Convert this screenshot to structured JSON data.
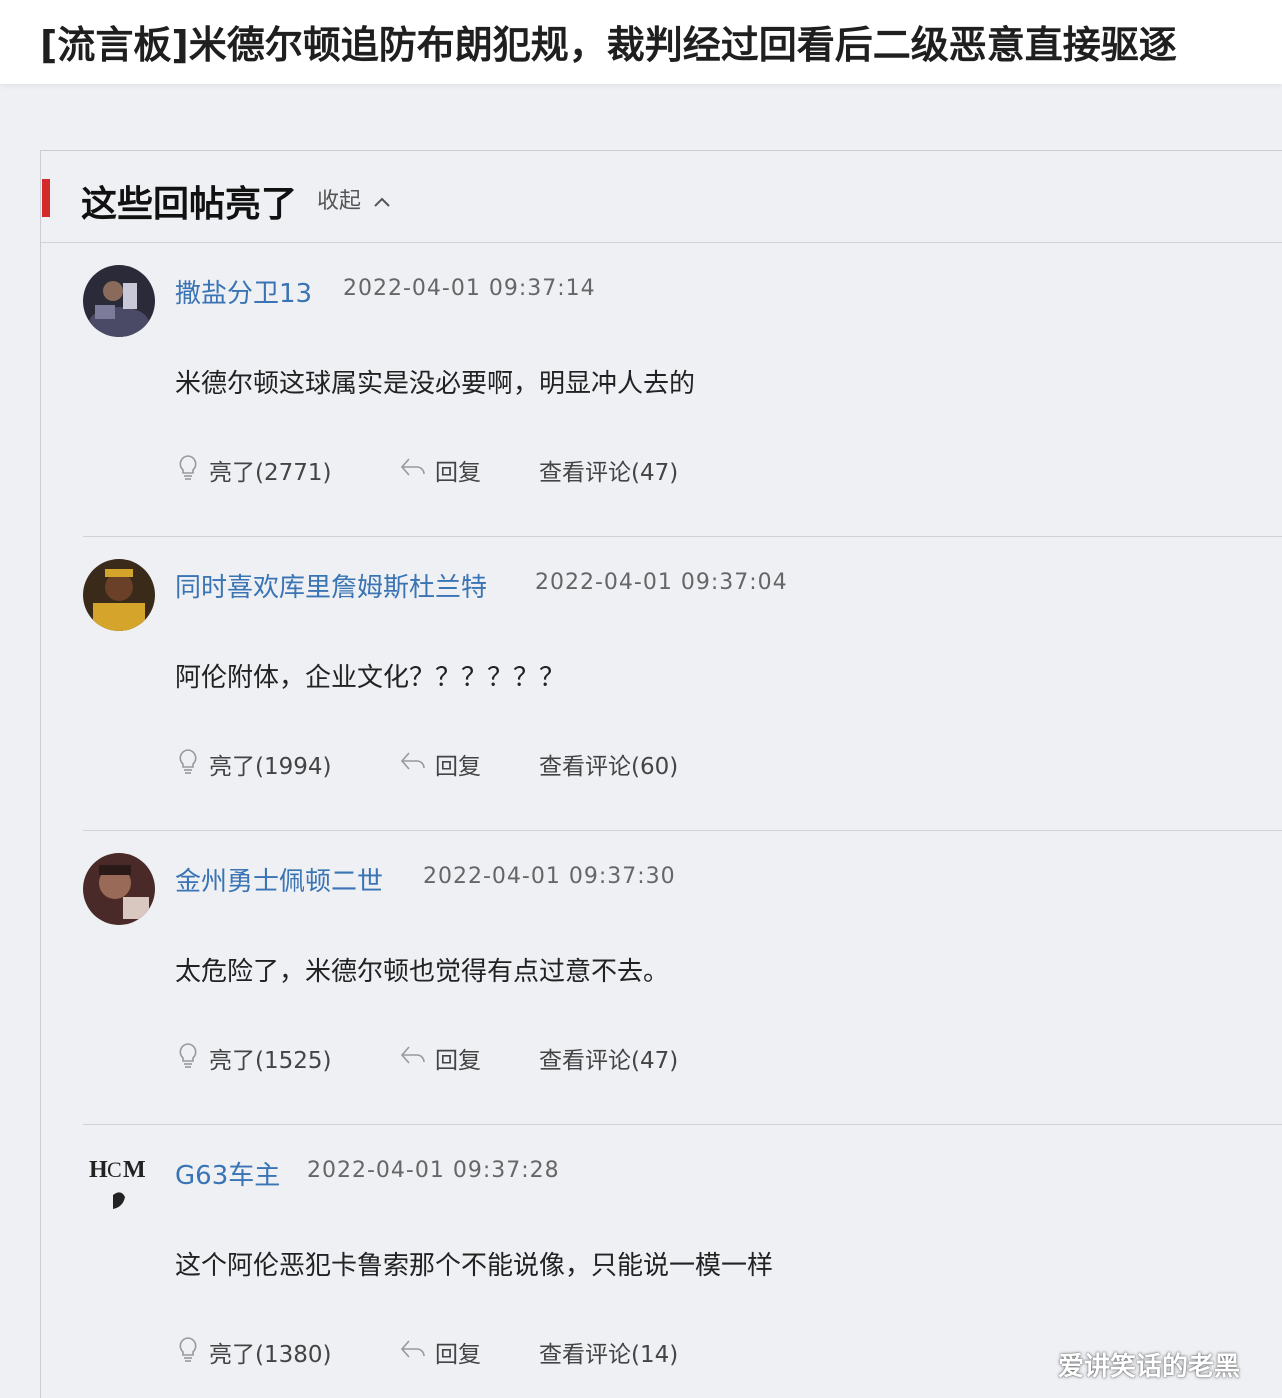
{
  "page": {
    "title": "[流言板]米德尔顿追防布朗犯规，裁判经过回看后二级恶意直接驱逐"
  },
  "section": {
    "title": "这些回帖亮了",
    "collapse_label": "收起",
    "accent_color": "#d42a2a"
  },
  "posts": [
    {
      "username": "撒盐分卫13",
      "time": "2022-04-01 09:37:14",
      "content": "米德尔顿这球属实是没必要啊，明显冲人去的",
      "like": "亮了(2771)",
      "reply": "回复",
      "comments": "查看评论(47)"
    },
    {
      "username": "同时喜欢库里詹姆斯杜兰特",
      "time": "2022-04-01 09:37:04",
      "content": "阿伦附体，企业文化？？？？？？",
      "like": "亮了(1994)",
      "reply": "回复",
      "comments": "查看评论(60)"
    },
    {
      "username": "金州勇士佩顿二世",
      "time": "2022-04-01 09:37:30",
      "content": "太危险了，米德尔顿也觉得有点过意不去。",
      "like": "亮了(1525)",
      "reply": "回复",
      "comments": "查看评论(47)"
    },
    {
      "username": "G63车主",
      "time": "2022-04-01 09:37:28",
      "content": "这个阿伦恶犯卡鲁索那个不能说像，只能说一模一样",
      "like": "亮了(1380)",
      "reply": "回复",
      "comments": "查看评论(14)"
    }
  ],
  "watermark": "爱讲笑话的老黑",
  "link_color": "#3a74b4"
}
